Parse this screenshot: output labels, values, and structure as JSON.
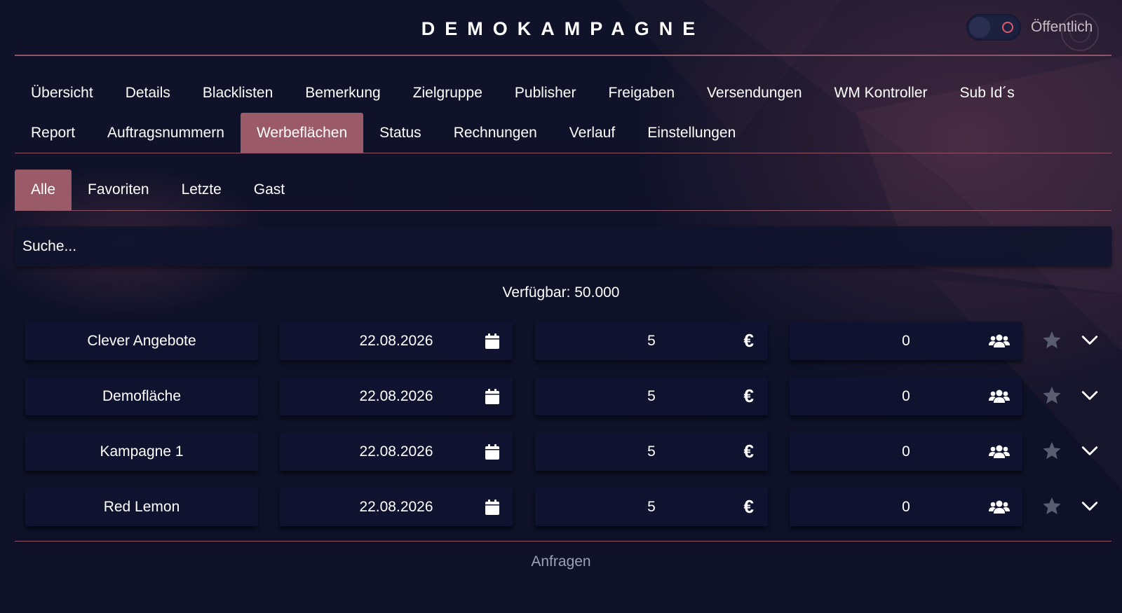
{
  "header": {
    "title": "DEMOKAMPAGNE",
    "public_label": "Öffentlich"
  },
  "main_nav": {
    "row1": [
      "Übersicht",
      "Details",
      "Blacklisten",
      "Bemerkung",
      "Zielgruppe",
      "Publisher",
      "Freigaben",
      "Versendungen",
      "WM Kontroller",
      "Sub Id´s"
    ],
    "row2": [
      "Report",
      "Auftragsnummern",
      "Werbeflächen",
      "Status",
      "Rechnungen",
      "Verlauf",
      "Einstellungen"
    ],
    "active": "Werbeflächen"
  },
  "sub_nav": {
    "items": [
      "Alle",
      "Favoriten",
      "Letzte",
      "Gast"
    ],
    "active": "Alle"
  },
  "search": {
    "placeholder": "Suche..."
  },
  "available_text": "Verfügbar: 50.000",
  "rows": [
    {
      "name": "Clever Angebote",
      "date": "22.08.2026",
      "price": "5",
      "users": "0"
    },
    {
      "name": "Demofläche",
      "date": "22.08.2026",
      "price": "5",
      "users": "0"
    },
    {
      "name": "Kampagne 1",
      "date": "22.08.2026",
      "price": "5",
      "users": "0"
    },
    {
      "name": "Red Lemon",
      "date": "22.08.2026",
      "price": "5",
      "users": "0"
    }
  ],
  "icons": {
    "date": "calendar-icon",
    "price": "euro-icon",
    "users": "users-icon",
    "favorite": "star-icon",
    "expand": "chevron-down-icon"
  },
  "euro_symbol": "€",
  "request_label": "Anfragen",
  "colors": {
    "background": "#0f1229",
    "accent": "#9b5a68",
    "divider": "#8d5566",
    "cell": "#0f1330",
    "star_inactive": "#5a5d70"
  }
}
